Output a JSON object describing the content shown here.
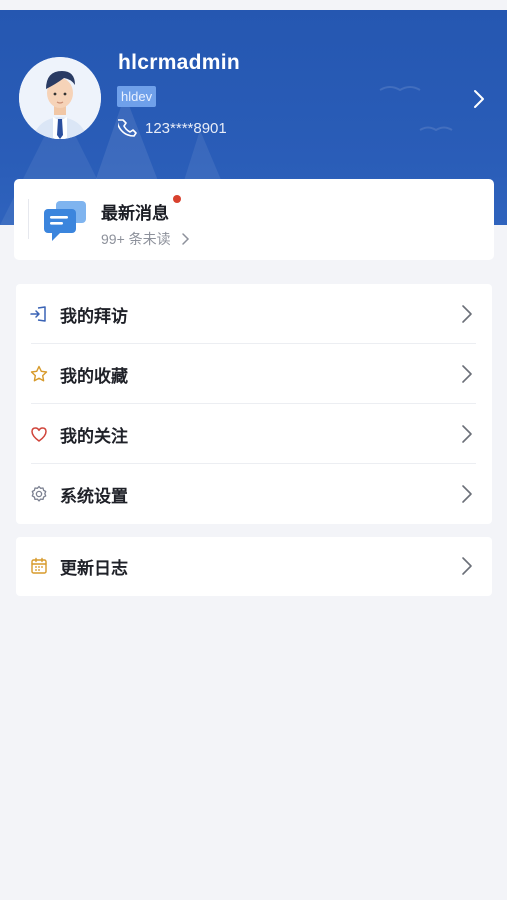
{
  "profile": {
    "username": "hlcrmadmin",
    "role": "hldev",
    "phone": "123****8901"
  },
  "messages": {
    "title": "最新消息",
    "unread": "99+ 条未读"
  },
  "menu_group_1": [
    {
      "label": "我的拜访",
      "icon": "visit-icon"
    },
    {
      "label": "我的收藏",
      "icon": "star-icon"
    },
    {
      "label": "我的关注",
      "icon": "heart-icon"
    },
    {
      "label": "系统设置",
      "icon": "gear-icon"
    }
  ],
  "menu_group_2": [
    {
      "label": "更新日志",
      "icon": "calendar-icon"
    }
  ],
  "colors": {
    "header_blue": "#2557b1",
    "badge_blue": "#6fa0ea",
    "unread_dot": "#d8412e",
    "background": "#f3f4f8"
  }
}
